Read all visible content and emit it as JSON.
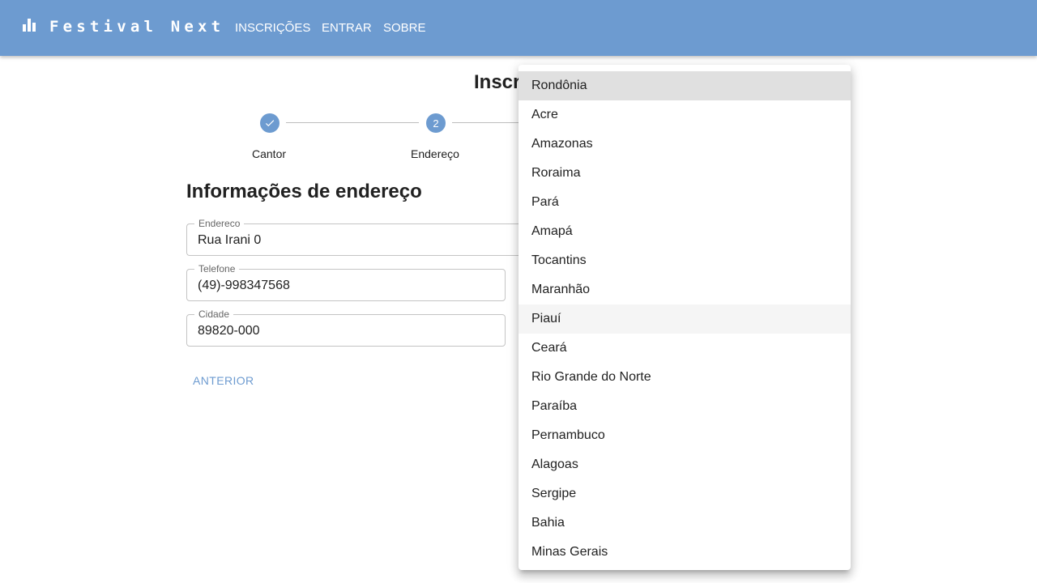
{
  "appbar": {
    "brand": "Festival Next",
    "nav": [
      "INSCRIÇÕES",
      "ENTRAR",
      "SOBRE"
    ]
  },
  "page": {
    "title": "Inscrição"
  },
  "stepper": {
    "steps": [
      {
        "label": "Cantor",
        "state": "completed"
      },
      {
        "label": "Endereço",
        "state": "active",
        "number": "2"
      }
    ]
  },
  "form": {
    "section_title": "Informações de endereço",
    "fields": {
      "endereco": {
        "label": "Endereco",
        "value": "Rua Irani 0"
      },
      "telefone": {
        "label": "Telefone",
        "value": "(49)-998347568"
      },
      "cidade": {
        "label": "Cidade",
        "value": "89820-000"
      }
    },
    "back_button": "ANTERIOR"
  },
  "estado_menu": {
    "selected": "Rondônia",
    "hovered": "Piauí",
    "options": [
      "Rondônia",
      "Acre",
      "Amazonas",
      "Roraima",
      "Pará",
      "Amapá",
      "Tocantins",
      "Maranhão",
      "Piauí",
      "Ceará",
      "Rio Grande do Norte",
      "Paraíba",
      "Pernambuco",
      "Alagoas",
      "Sergipe",
      "Bahia",
      "Minas Gerais"
    ]
  },
  "colors": {
    "primary": "#6d9bd0",
    "selected_option_bg": "#e0e0e0",
    "hover_option_bg": "#f5f5f5"
  }
}
